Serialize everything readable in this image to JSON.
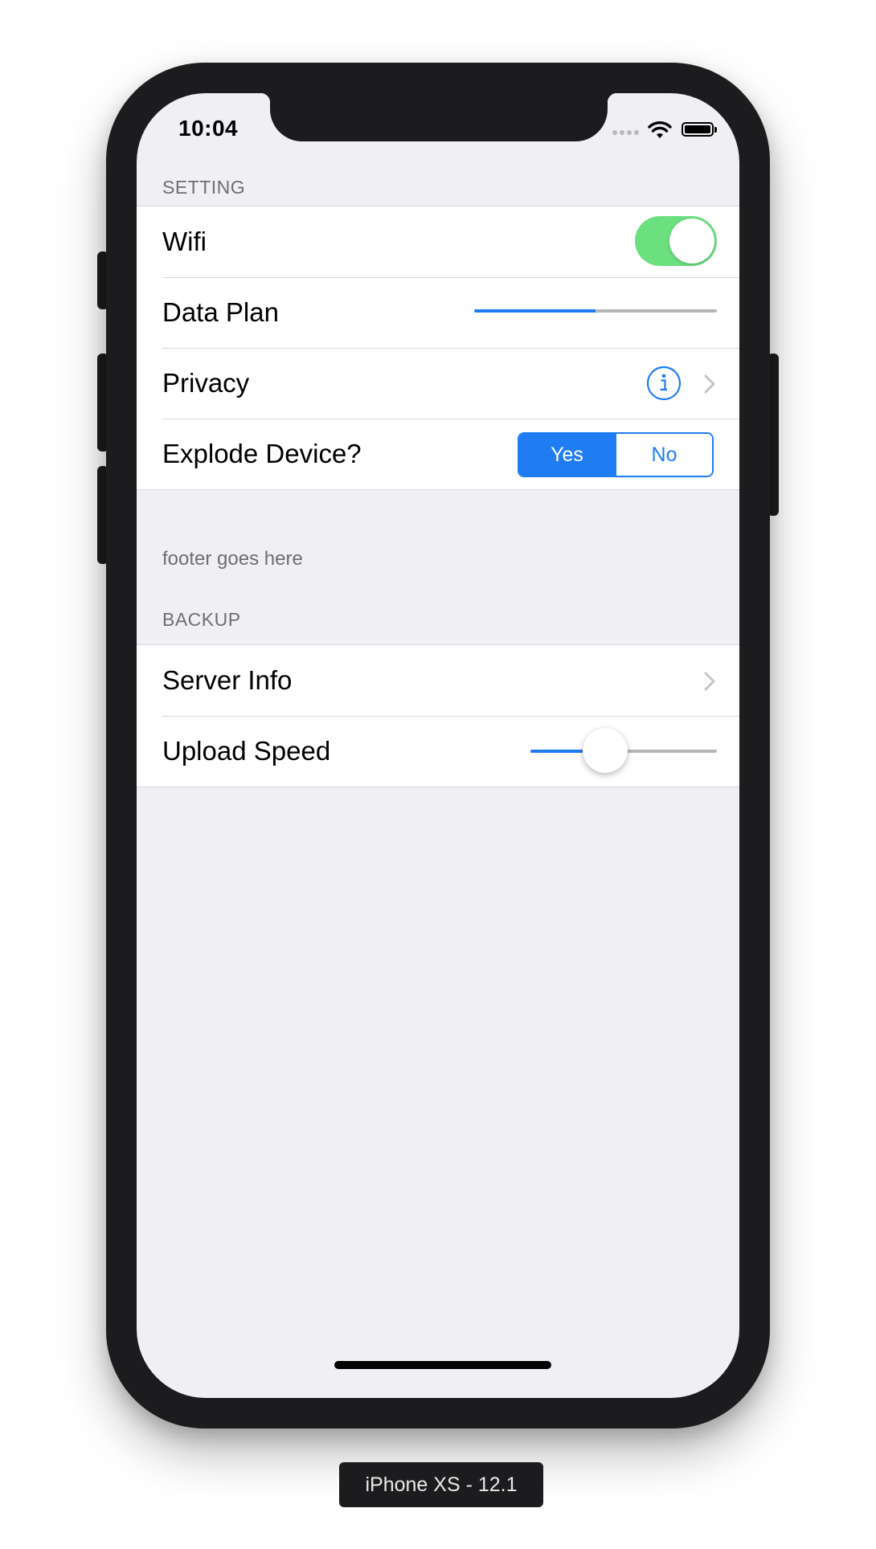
{
  "status_bar": {
    "time": "10:04",
    "icons": [
      "signal-icon",
      "wifi-icon",
      "battery-icon"
    ]
  },
  "sections": [
    {
      "header": "SETTING",
      "footer": "footer goes here",
      "rows": [
        {
          "label": "Wifi",
          "accessory": "toggle",
          "on": true
        },
        {
          "label": "Data Plan",
          "accessory": "progress",
          "progress": 0.5
        },
        {
          "label": "Privacy",
          "accessory": [
            "info-icon",
            "chevron-right-icon"
          ]
        },
        {
          "label": "Explode Device?",
          "accessory": "segmented",
          "segments": [
            "Yes",
            "No"
          ],
          "selected": "Yes"
        }
      ]
    },
    {
      "header": "BACKUP",
      "rows": [
        {
          "label": "Server Info",
          "accessory": "chevron-right-icon"
        },
        {
          "label": "Upload Speed",
          "accessory": "slider",
          "value": 0.4
        }
      ]
    }
  ],
  "device_label": "iPhone XS - 12.1",
  "colors": {
    "tint": "#1f7cf3",
    "switch_on": "#4cd964",
    "background": "#efeff4",
    "secondary_text": "#6d6d72"
  }
}
